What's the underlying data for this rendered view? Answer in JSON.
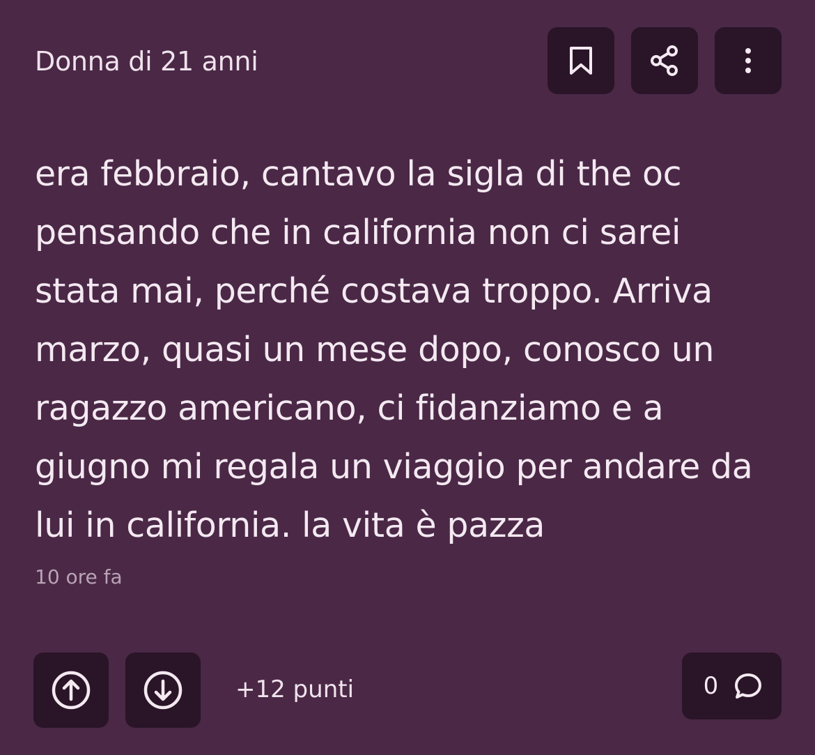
{
  "header": {
    "author": "Donna di 21 anni",
    "icons": {
      "bookmark": "bookmark-icon",
      "share": "share-icon",
      "more": "more-vertical-icon"
    }
  },
  "post": {
    "text": "era febbraio, cantavo la sigla di the oc\npensando che in california non ci sarei\nstata mai, perché costava troppo. Arriva\nmarzo, quasi un mese dopo, conosco un\nragazzo americano, ci fidanziamo e a\ngiugno mi regala un viaggio per andare da\nlui in california. la vita è pazza",
    "timestamp": "10 ore fa"
  },
  "footer": {
    "points": "+12 punti",
    "comments_count": "0",
    "icons": {
      "upvote": "arrow-up-circle-icon",
      "downvote": "arrow-down-circle-icon",
      "comment": "comment-bubble-icon"
    }
  },
  "colors": {
    "background": "#4a2846",
    "button": "#2a1528",
    "text": "#f4e9f1",
    "muted": "#b9a3b5"
  }
}
